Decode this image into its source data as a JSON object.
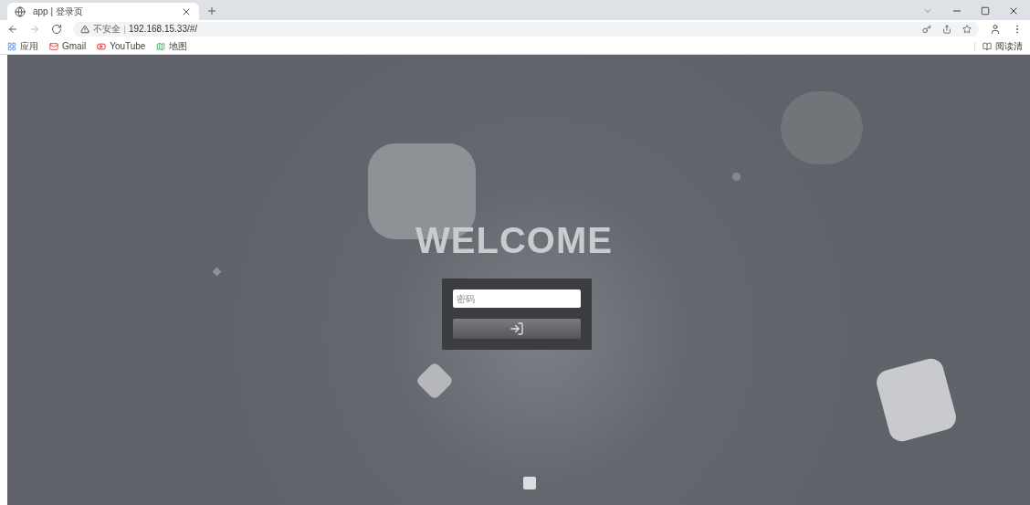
{
  "browser": {
    "tab": {
      "title": "app | 登录页",
      "selected": true
    },
    "address": {
      "security": "不安全",
      "url": "192.168.15.33/#/"
    },
    "bookmarks": [
      {
        "label": "应用"
      },
      {
        "label": "Gmail"
      },
      {
        "label": "YouTube"
      },
      {
        "label": "地图"
      }
    ],
    "reading_list": "阅读清"
  },
  "page": {
    "heading": "WELCOME",
    "password": {
      "placeholder": "密码"
    }
  }
}
